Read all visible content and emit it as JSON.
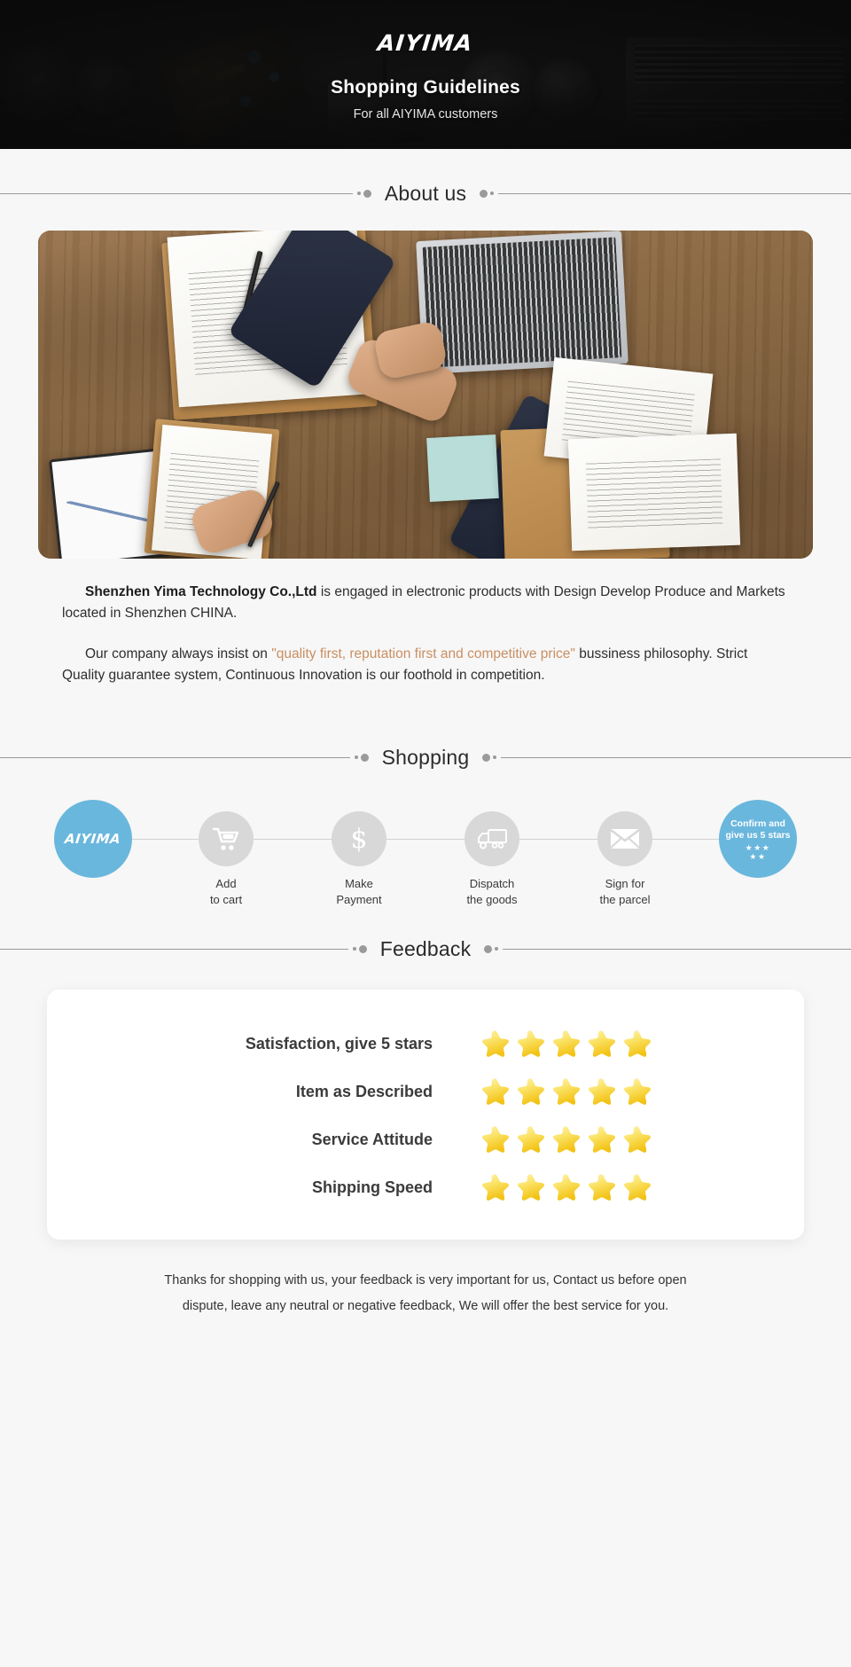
{
  "hero": {
    "brand": "AIYIMA",
    "title": "Shopping Guidelines",
    "subtitle": "For all AIYIMA customers"
  },
  "sections": {
    "about": {
      "title": "About us"
    },
    "shopping": {
      "title": "Shopping"
    },
    "feedback": {
      "title": "Feedback"
    }
  },
  "about": {
    "paragraph1_strong": "Shenzhen Yima Technology Co.,Ltd",
    "paragraph1_rest": " is engaged in electronic products with Design Develop Produce and Markets located in Shenzhen CHINA.",
    "paragraph2_pre": "Our company always insist on ",
    "paragraph2_quote": "\"quality first, reputation first and competitive price\"",
    "paragraph2_post": " bussiness philosophy. Strict Quality guarantee system, Continuous Innovation is our foothold in competition."
  },
  "shopping_flow": {
    "steps": [
      {
        "icon": "aiyima-logo-icon",
        "brand": "AIYIMA",
        "label_line1": "",
        "label_line2": "",
        "type": "brand"
      },
      {
        "icon": "shopping-cart-icon",
        "label_line1": "Add",
        "label_line2": "to cart",
        "type": "step"
      },
      {
        "icon": "dollar-sign-icon",
        "label_line1": "Make",
        "label_line2": "Payment",
        "type": "step"
      },
      {
        "icon": "delivery-truck-icon",
        "label_line1": "Dispatch",
        "label_line2": "the goods",
        "type": "step"
      },
      {
        "icon": "envelope-icon",
        "label_line1": "Sign for",
        "label_line2": "the parcel",
        "type": "step"
      },
      {
        "icon": "five-stars-icon",
        "confirm_line1": "Confirm and",
        "confirm_line2": "give us 5 stars",
        "stars_row1": "★★★",
        "stars_row2": "★★",
        "type": "confirm"
      }
    ]
  },
  "feedback": {
    "rows": [
      {
        "label": "Satisfaction, give 5 stars",
        "stars": 5
      },
      {
        "label": "Item as Described",
        "stars": 5
      },
      {
        "label": "Service Attitude",
        "stars": 5
      },
      {
        "label": "Shipping Speed",
        "stars": 5
      }
    ]
  },
  "footer": {
    "line1": "Thanks for shopping with us, your feedback is very important for us, Contact us before open",
    "line2": "dispute, leave any neutral or negative feedback, We will offer the best service for you."
  },
  "colors": {
    "accent_blue": "#6ab7dd",
    "banner_bg": "#1a1a1a",
    "page_bg": "#f7f7f7",
    "quote_tan": "#c98f62",
    "star_yellow": "#f7d842",
    "circle_grey": "#d8d8d8"
  }
}
